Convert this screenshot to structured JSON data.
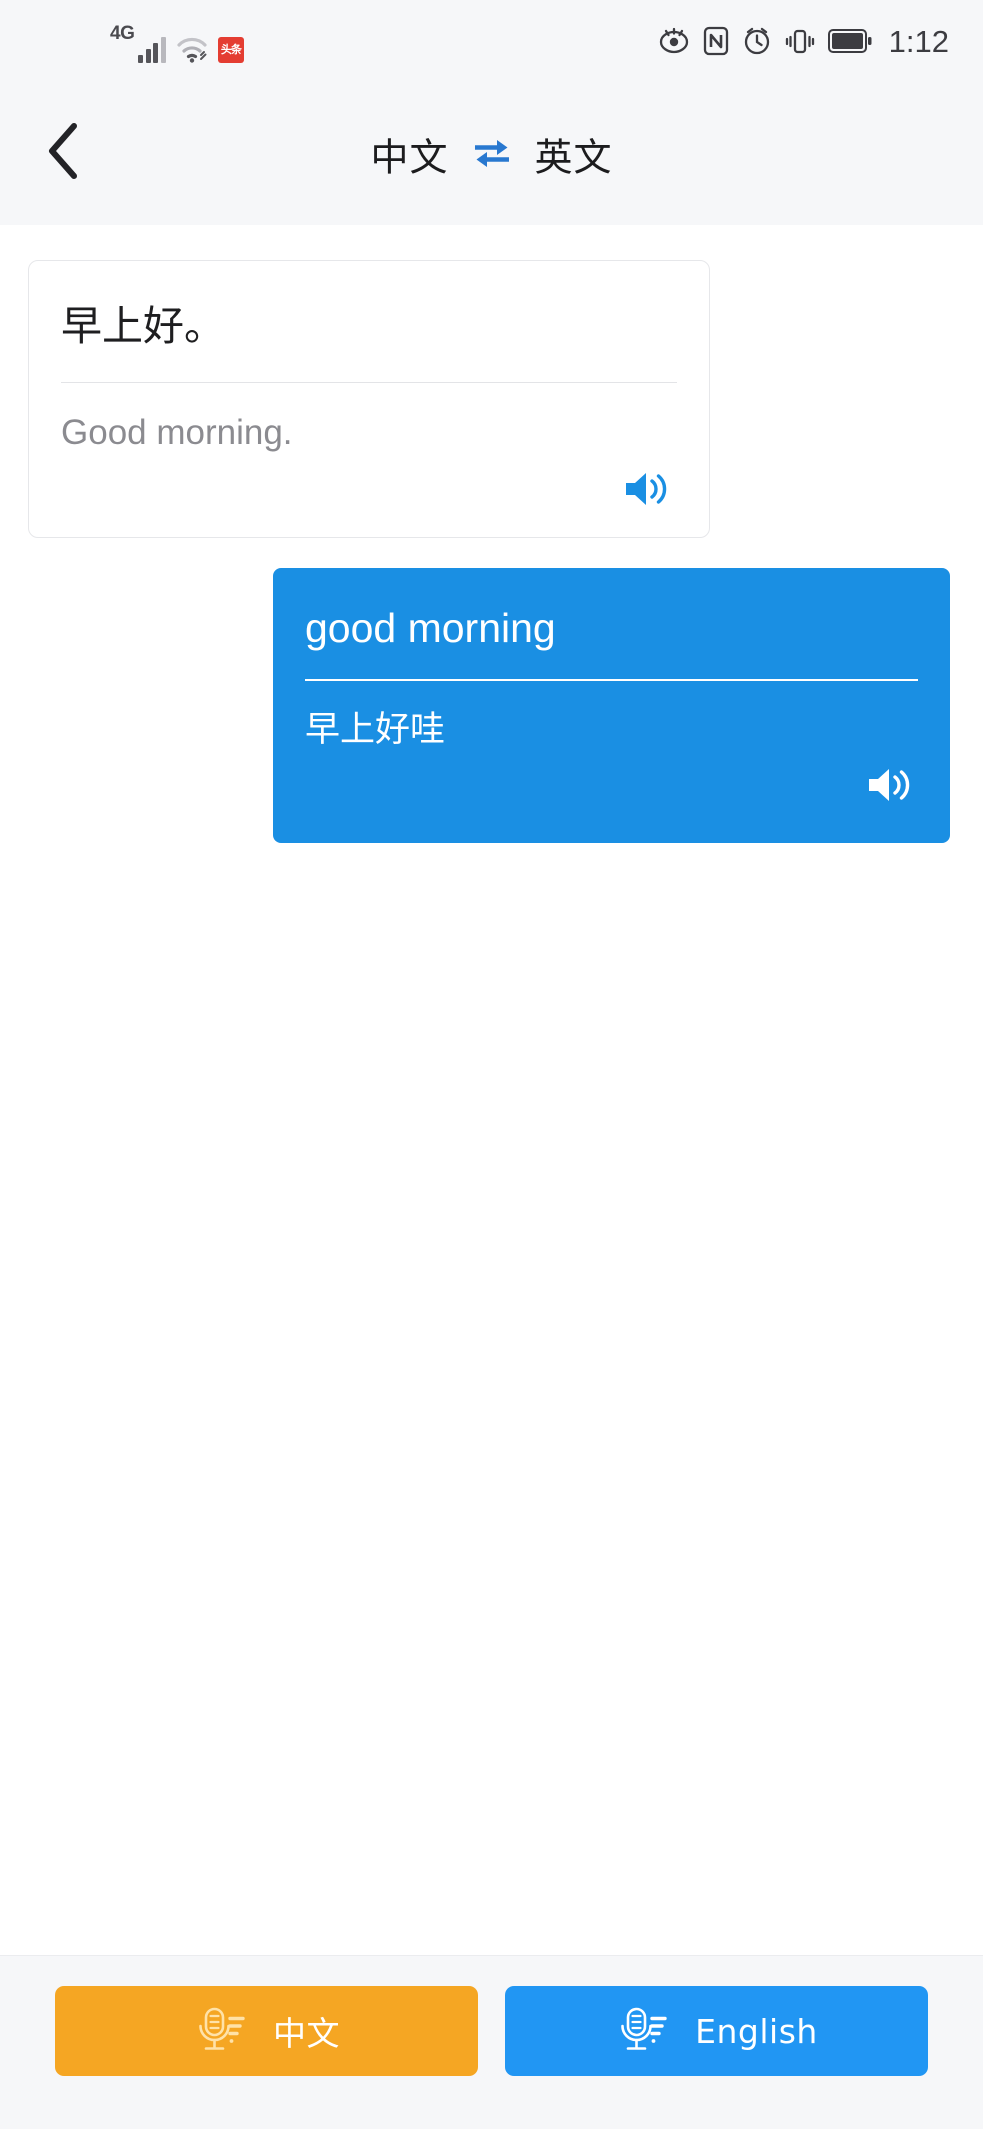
{
  "status_bar": {
    "network_type": "4G",
    "signal_icon": "cellular-signal-icon",
    "wifi_icon": "wifi-icon",
    "app_badge_text": "头条",
    "app_badge_color": "#e43d32",
    "right_icons": [
      "eye-comfort-icon",
      "nfc-icon",
      "alarm-clock-icon",
      "vibrate-icon",
      "battery-icon"
    ],
    "time": "1:12"
  },
  "header": {
    "back_icon": "chevron-left-icon",
    "source_language": "中文",
    "swap_icon": "swap-horizontal-icon",
    "swap_color": "#2878d0",
    "target_language": "英文"
  },
  "conversation": [
    {
      "side": "source",
      "primary_text": "早上好。",
      "secondary_text": "Good morning.",
      "speaker_icon": "speaker-icon",
      "accent_color": "#1a8fe3"
    },
    {
      "side": "target",
      "primary_text": "good morning",
      "secondary_text": "早上好哇",
      "speaker_icon": "speaker-icon",
      "accent_color": "#ffffff",
      "bubble_color": "#1a8fe3"
    }
  ],
  "bottom_bar": {
    "source_button": {
      "label": "中文",
      "icon": "microphone-icon",
      "color": "#f5a623"
    },
    "target_button": {
      "label": "English",
      "icon": "microphone-icon",
      "color": "#2196f3"
    }
  }
}
